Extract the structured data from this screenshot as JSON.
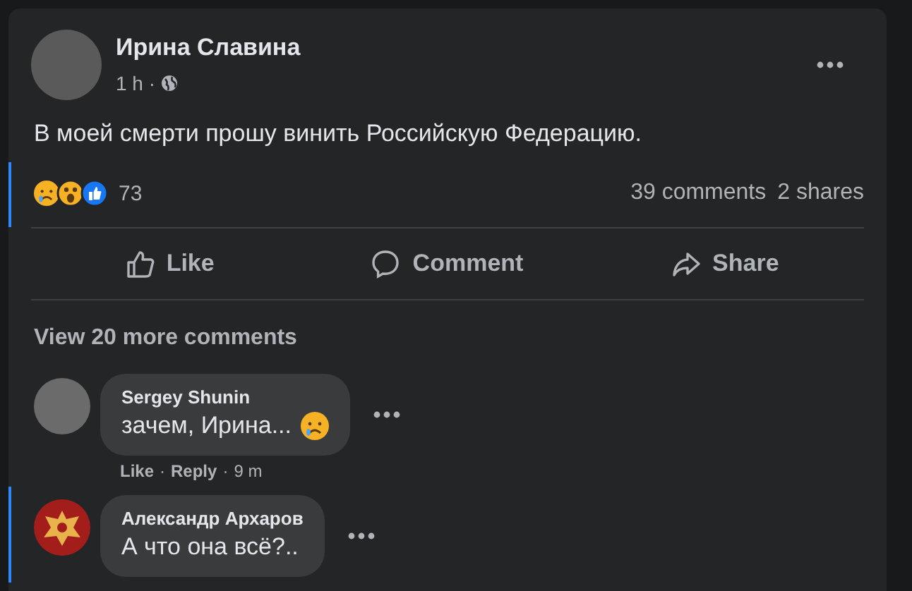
{
  "post": {
    "author": "Ирина Славина",
    "time": "1 h ·",
    "text": "В моей смерти прошу винить Российскую Федерацию.",
    "reaction_count": "73",
    "comments_count": "39 comments",
    "shares_count": "2 shares",
    "actions": [
      {
        "kind": "like",
        "label": "Like"
      },
      {
        "kind": "comment",
        "label": "Comment"
      },
      {
        "kind": "share",
        "label": "Share"
      }
    ]
  },
  "view_more": "View 20 more comments",
  "comments": [
    {
      "kind": "photo",
      "author": "Sergey Shunin",
      "text": "зачем, Ирина...",
      "sad_emoji": true,
      "links": [
        "Like",
        "·",
        "Reply",
        "·"
      ],
      "time": "9 m"
    },
    {
      "kind": "emblem",
      "author": "Александр Архаров",
      "text": "А что она всё?..",
      "sad_emoji": false
    }
  ]
}
